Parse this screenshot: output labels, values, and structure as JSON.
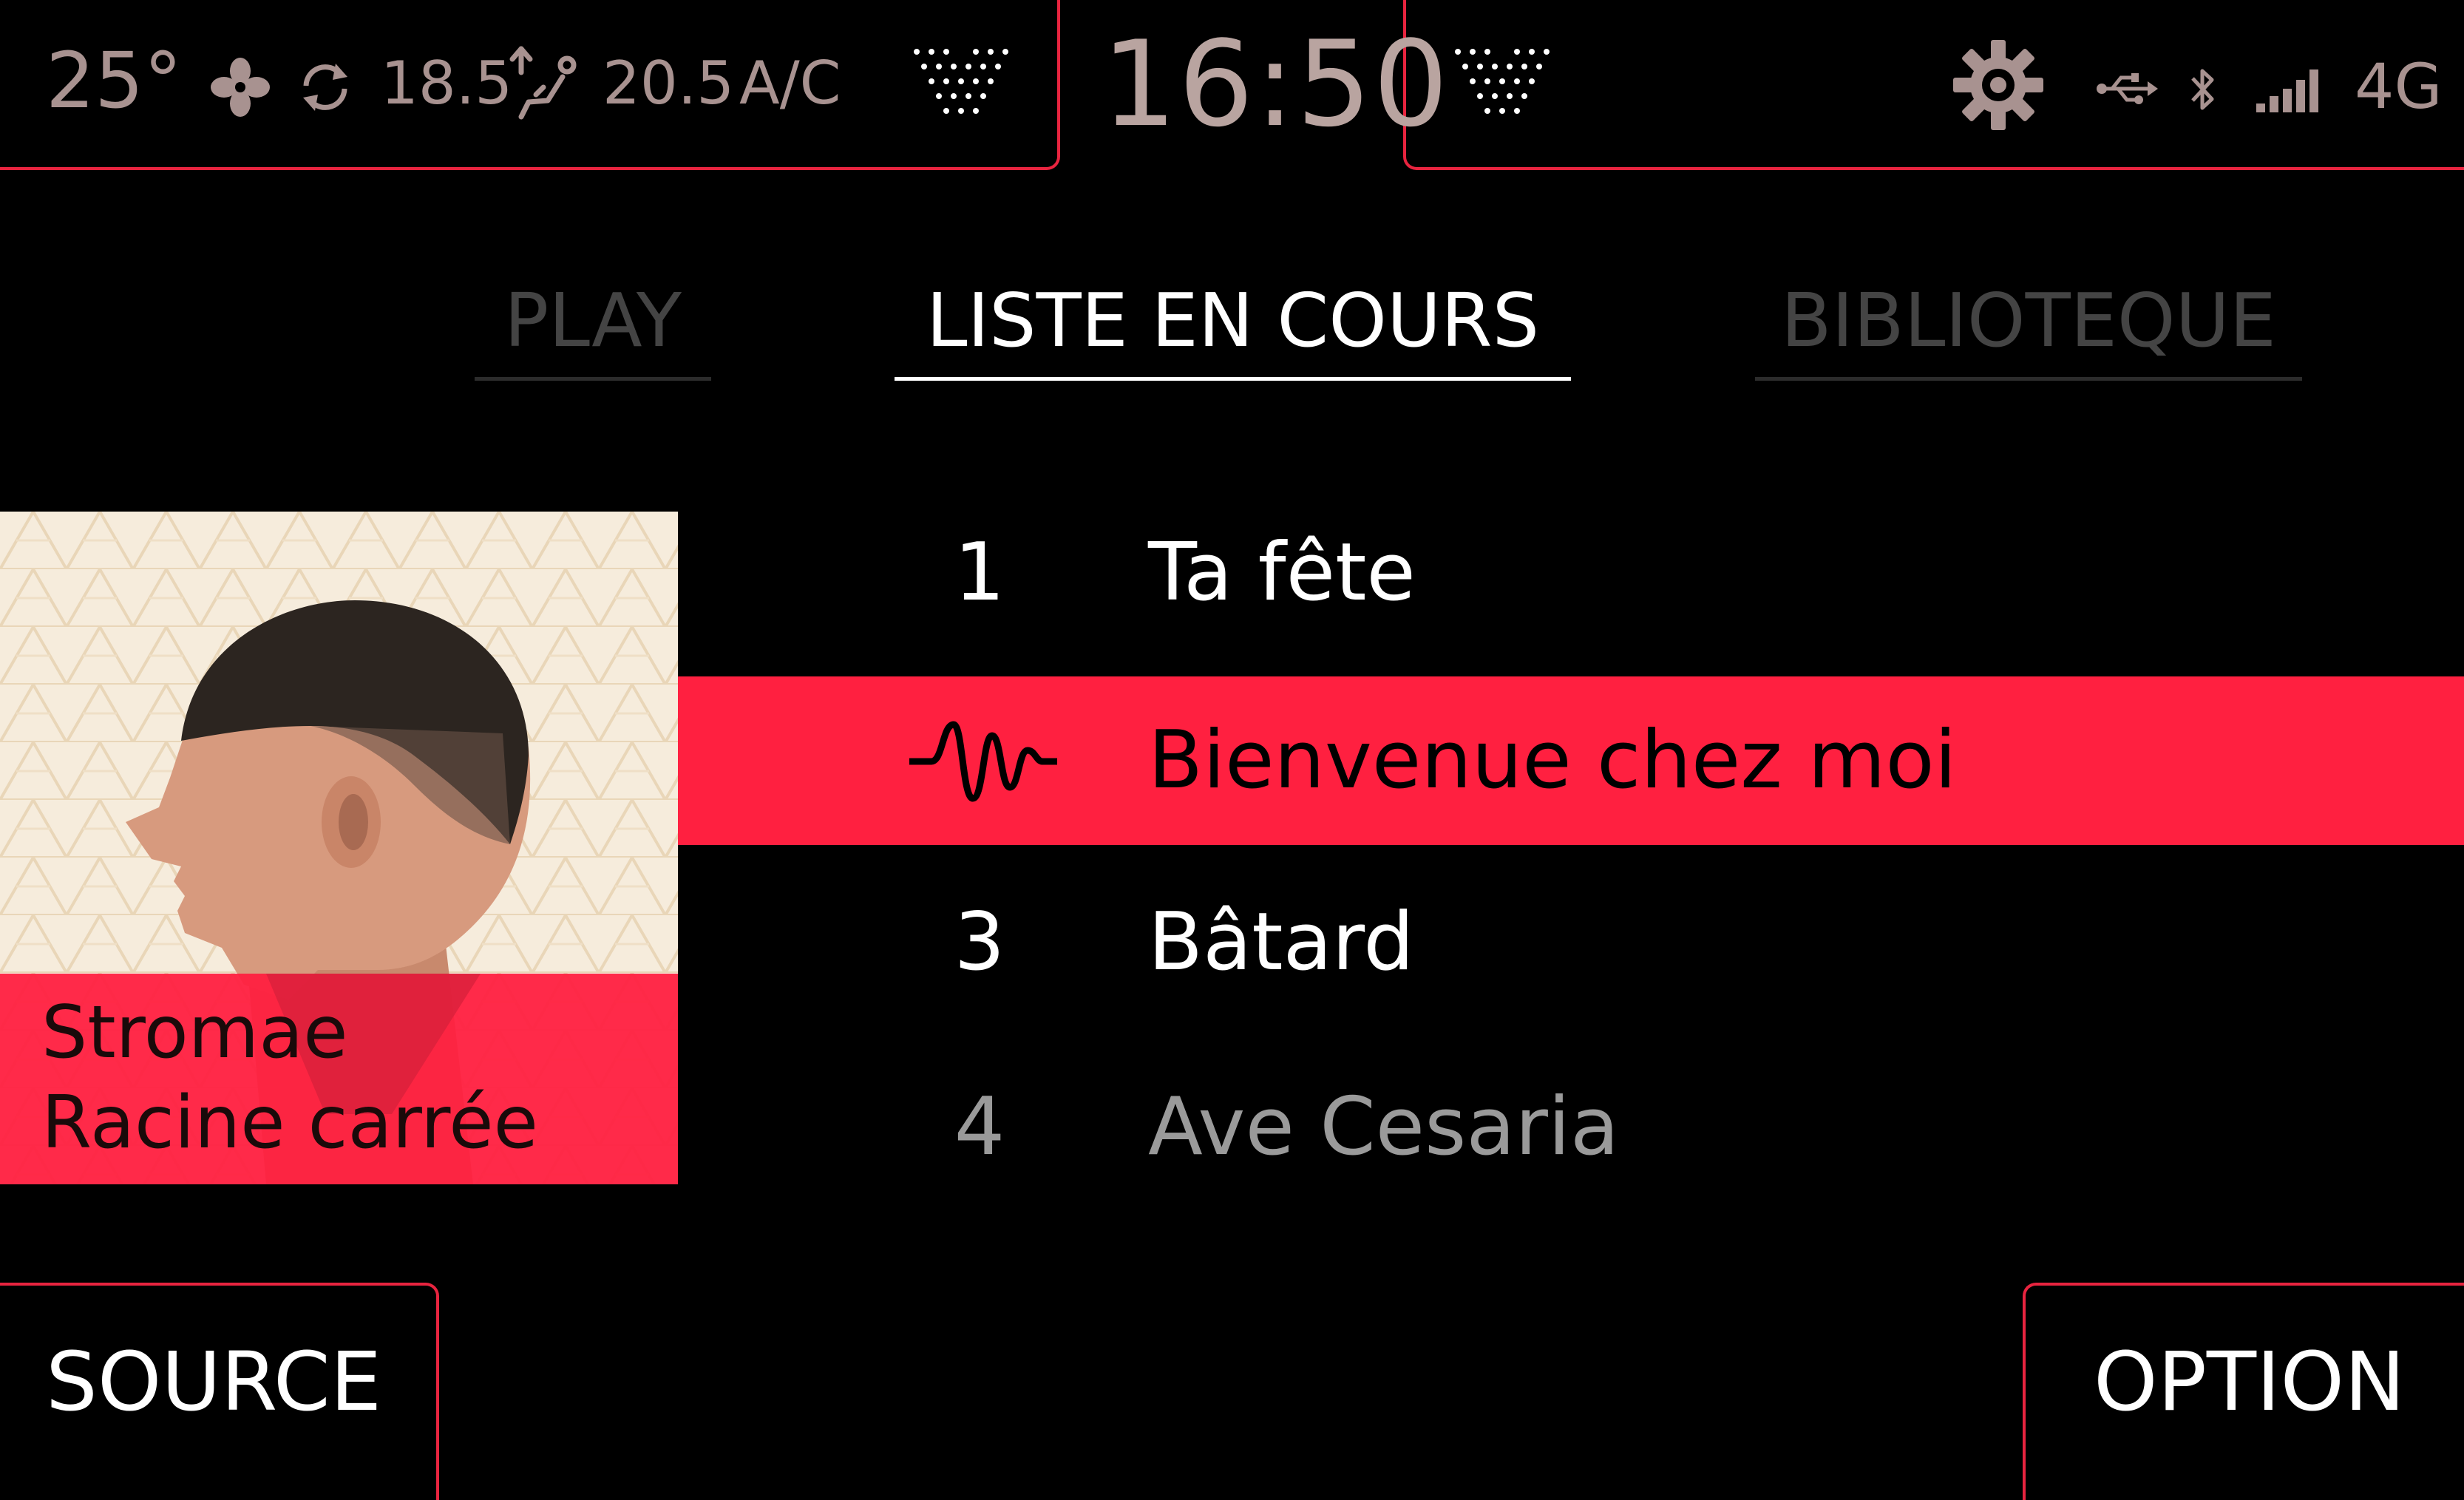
{
  "status_bar": {
    "temperature": "25°",
    "left_temp": "18.5",
    "right_temp": "20.5",
    "ac_label": "A/C",
    "clock": "16:50",
    "network": "4G",
    "icons": [
      "fan-icon",
      "recirculation-icon",
      "seat-heating-icon",
      "heater-grid-icon",
      "settings-gear-icon",
      "usb-icon",
      "bluetooth-icon",
      "signal-icon"
    ]
  },
  "tabs": [
    {
      "label": "PLAY",
      "active": false
    },
    {
      "label": "LISTE EN COURS",
      "active": true
    },
    {
      "label": "BIBLIOTEQUE",
      "active": false
    }
  ],
  "album": {
    "artist": "Stromae",
    "title": "Racine carrée"
  },
  "tracks": [
    {
      "number": "1",
      "title": "Ta fête",
      "playing": false
    },
    {
      "number": "",
      "title": "Bienvenue chez moi",
      "playing": true
    },
    {
      "number": "3",
      "title": "Bâtard",
      "playing": false
    },
    {
      "number": "4",
      "title": "Ave Cesaria",
      "playing": false
    }
  ],
  "buttons": {
    "source": "SOURCE",
    "option": "OPTION"
  },
  "colors": {
    "accent": "#e8243f",
    "highlight": "#ff2040",
    "status_text": "#a89290"
  }
}
